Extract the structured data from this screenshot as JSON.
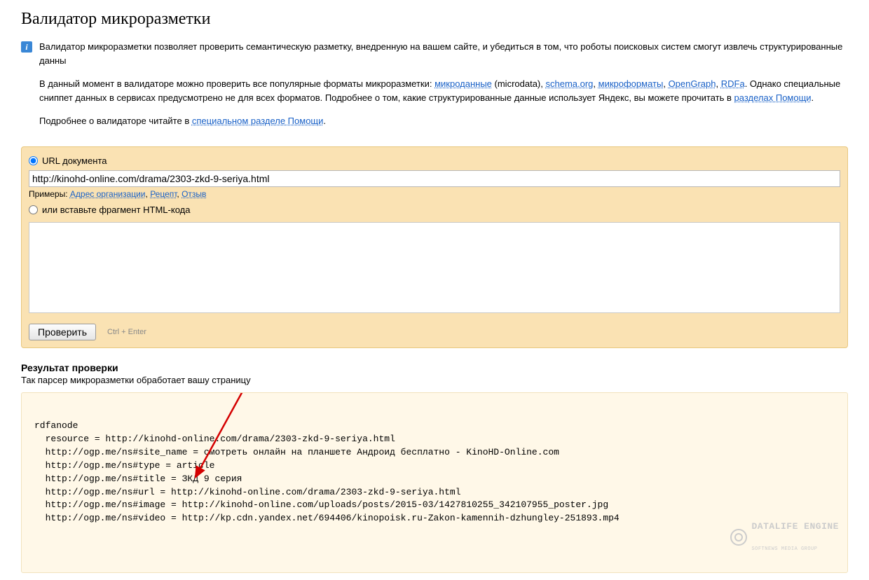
{
  "title": "Валидатор микроразметки",
  "info": {
    "p1_prefix": "Валидатор микроразметки позволяет проверить семантическую разметку, внедренную на вашем сайте, и убедиться в том, что роботы поисковых систем смогут извлечь структурированные данны",
    "p2_part1": "В данный момент в валидаторе можно проверить все популярные форматы микроразметки: ",
    "link_microdata": "микроданные",
    "p2_part2": " (microdata), ",
    "link_schema": "schema.org",
    "p2_sep1": ", ",
    "link_microformats": "микроформаты",
    "p2_sep2": ", ",
    "link_opengraph": "OpenGraph",
    "p2_sep3": ", ",
    "link_rdfa": "RDFa",
    "p2_part3": ". Однако специальные сниппет данных в сервисах предусмотрено не для всех форматов. Подробнее о том, какие структурированные данные использует Яндекс, вы можете прочитать в ",
    "link_help_sections": "разделах Помощи",
    "p2_end": ".",
    "p3_part1": "Подробнее о валидаторе читайте в ",
    "link_special": "специальном разделе Помощи",
    "p3_end": "."
  },
  "form": {
    "radio_url_label": "URL документа",
    "url_value": "http://kinohd-online.com/drama/2303-zkd-9-seriya.html",
    "examples_label": "Примеры: ",
    "ex1": "Адрес организации",
    "ex_sep1": ", ",
    "ex2": "Рецепт",
    "ex_sep2": ", ",
    "ex3": "Отзыв",
    "radio_html_label": "или вставьте фрагмент HTML-кода",
    "submit_label": "Проверить",
    "hint": "Ctrl + Enter"
  },
  "result": {
    "title": "Результат проверки",
    "subtitle": "Так парсер микроразметки обработает вашу страницу",
    "lines": [
      "rdfanode",
      "  resource = http://kinohd-online.com/drama/2303-zkd-9-seriya.html",
      "  http://ogp.me/ns#site_name = смотреть онлайн на планшете Андроид бесплатно - KinoHD-Online.com",
      "  http://ogp.me/ns#type = article",
      "  http://ogp.me/ns#title = ЗКД 9 серия",
      "  http://ogp.me/ns#url = http://kinohd-online.com/drama/2303-zkd-9-seriya.html",
      "  http://ogp.me/ns#image = http://kinohd-online.com/uploads/posts/2015-03/1427810255_342107955_poster.jpg",
      "  http://ogp.me/ns#video = http://kp.cdn.yandex.net/694406/kinopoisk.ru-Zakon-kamennih-dzhungley-251893.mp4"
    ]
  },
  "watermark": {
    "main": "DATALIFE ENGINE",
    "sub": "SOFTNEWS MEDIA GROUP"
  }
}
